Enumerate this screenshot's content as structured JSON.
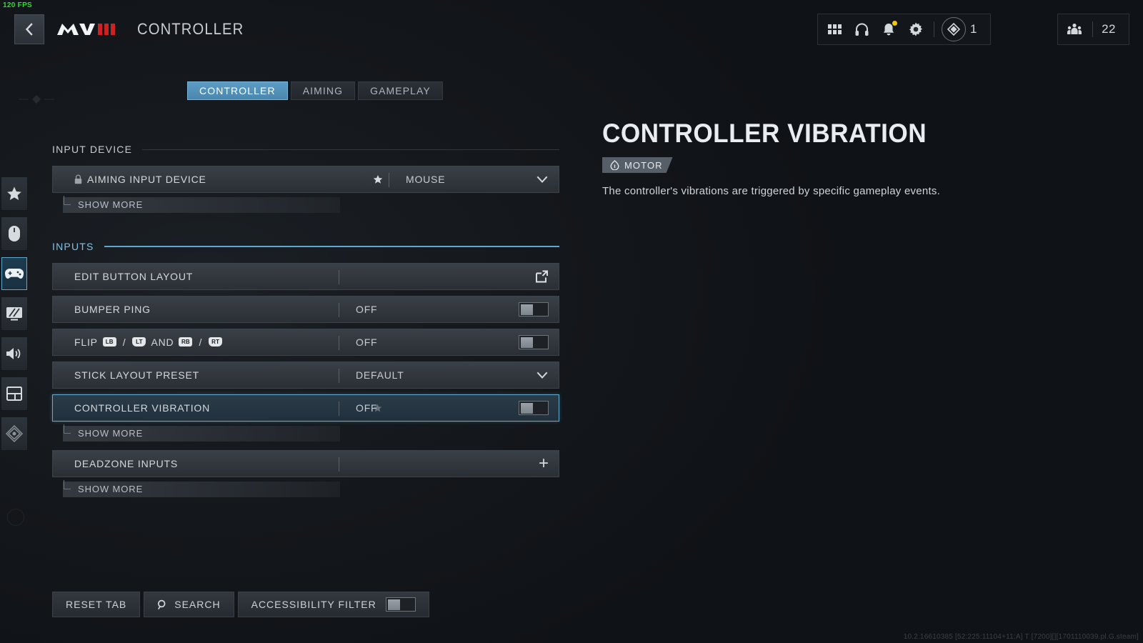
{
  "fps": "120 FPS",
  "header": {
    "back_icon": "chevron-left-icon",
    "logo_text": "MWIII",
    "title": "CONTROLLER",
    "hud": {
      "icons": [
        {
          "name": "grid-apps-icon",
          "label": "Apps"
        },
        {
          "name": "headset-icon",
          "label": "Audio"
        },
        {
          "name": "bell-notification-icon",
          "label": "Notifications",
          "badge": true
        },
        {
          "name": "gear-settings-icon",
          "label": "Settings"
        }
      ],
      "rank_icon": "rank-emblem-icon",
      "rank_value": "1",
      "players_icon": "squad-players-icon",
      "players_value": "22"
    }
  },
  "rail": {
    "items": [
      {
        "name": "sidebar-item-favorites",
        "icon": "star-icon",
        "active": false
      },
      {
        "name": "sidebar-item-mouse-keyboard",
        "icon": "mouse-icon",
        "active": false
      },
      {
        "name": "sidebar-item-controller",
        "icon": "gamepad-icon",
        "active": true
      },
      {
        "name": "sidebar-item-graphics",
        "icon": "monitor-icon",
        "active": false
      },
      {
        "name": "sidebar-item-audio",
        "icon": "speaker-icon",
        "active": false
      },
      {
        "name": "sidebar-item-interface",
        "icon": "layout-panels-icon",
        "active": false
      },
      {
        "name": "sidebar-item-accessibility",
        "icon": "signal-waves-icon",
        "active": false
      }
    ]
  },
  "tabs": [
    {
      "label": "CONTROLLER",
      "active": true
    },
    {
      "label": "AIMING",
      "active": false
    },
    {
      "label": "GAMEPLAY",
      "active": false
    }
  ],
  "sections": [
    {
      "name": "input-device",
      "heading": "INPUT DEVICE",
      "accent": false,
      "rows": [
        {
          "name": "aiming-input-device",
          "label": "AIMING INPUT DEVICE",
          "lock_icon": "lock-icon",
          "star_icon": "star-filled-icon",
          "value": "MOUSE",
          "control": "dropdown",
          "selected": false,
          "show_more": "SHOW MORE"
        }
      ]
    },
    {
      "name": "inputs",
      "heading": "INPUTS",
      "accent": true,
      "rows": [
        {
          "name": "edit-button-layout",
          "label": "EDIT BUTTON LAYOUT",
          "value": "",
          "control": "external-link",
          "selected": false
        },
        {
          "name": "bumper-ping",
          "label": "BUMPER PING",
          "value": "OFF",
          "control": "toggle",
          "toggle_on": false,
          "selected": false
        },
        {
          "name": "flip-bumpers-triggers",
          "label": "FLIP",
          "label_keys": [
            "LB",
            "LT",
            "AND",
            "RB",
            "RT"
          ],
          "value": "OFF",
          "control": "toggle",
          "toggle_on": false,
          "selected": false
        },
        {
          "name": "stick-layout-preset",
          "label": "STICK LAYOUT PRESET",
          "value": "DEFAULT",
          "control": "dropdown",
          "selected": false
        },
        {
          "name": "controller-vibration",
          "label": "CONTROLLER VIBRATION",
          "star_icon": "star-filled-icon",
          "value": "OFF",
          "control": "toggle",
          "toggle_on": false,
          "selected": true,
          "show_more": "SHOW MORE"
        },
        {
          "name": "deadzone-inputs",
          "label": "DEADZONE INPUTS",
          "value": "",
          "control": "plus",
          "selected": false,
          "show_more": "SHOW MORE"
        }
      ]
    }
  ],
  "bottom_bar": {
    "reset_label": "RESET TAB",
    "search_label": "SEARCH",
    "search_icon": "magnifier-icon",
    "accessibility_label": "ACCESSIBILITY FILTER",
    "accessibility_on": false
  },
  "detail": {
    "title": "CONTROLLER VIBRATION",
    "badge_icon": "motor-icon",
    "badge_label": "MOTOR",
    "description": "The controller's vibrations are triggered by specific gameplay events."
  },
  "version": "10.2.16610385 [52:225:11104+11:A] T [7200][][1701110039.pl.G.steam]",
  "colors": {
    "accent_blue": "#5ca8ce",
    "tab_active": "#5c9cc4",
    "fps_green": "#33dd33",
    "badge_yellow": "#f0c808",
    "logo_red": "#cc2222",
    "background": "#14171b"
  }
}
